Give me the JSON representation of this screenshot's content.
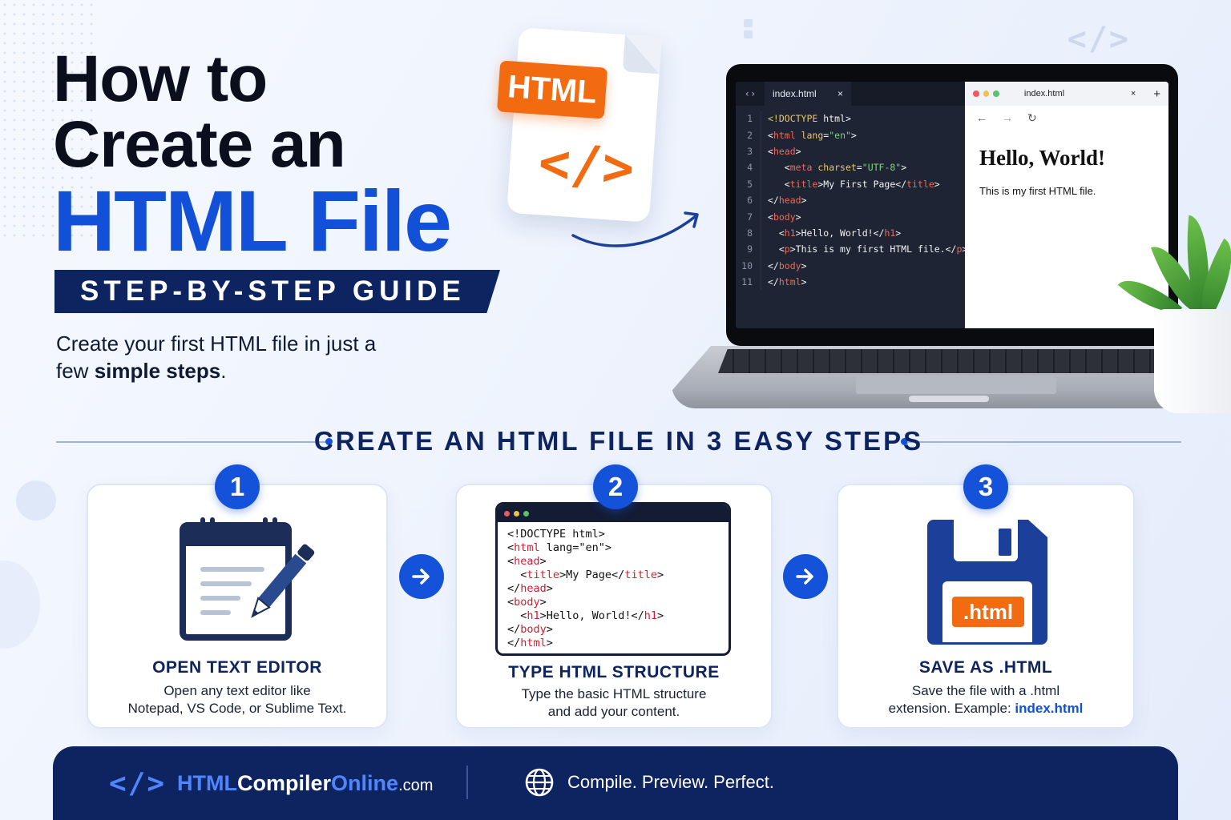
{
  "hero": {
    "title_line1": "How to",
    "title_line2": "Create an",
    "title_line3": "HTML File",
    "guide_banner": "STEP-BY-STEP GUIDE",
    "subtitle_part1": "Create your first HTML file in just a few ",
    "subtitle_bold": "simple steps",
    "subtitle_end": "."
  },
  "file_icon": {
    "badge": "HTML",
    "code_glyph": "</>"
  },
  "decor": {
    "code_glyph": "</>"
  },
  "editor": {
    "tab_icon": "‹›",
    "tab_name": "index.html",
    "tab_close": "×",
    "lines": [
      "1",
      "2",
      "3",
      "4",
      "5",
      "6",
      "7",
      "8",
      "9",
      "10",
      "11"
    ]
  },
  "browser": {
    "tab_name": "index.html",
    "tab_close": "×",
    "new_tab": "+",
    "nav_back": "←",
    "nav_forward": "→",
    "nav_reload": "↻",
    "heading": "Hello, World!",
    "paragraph": "This is my first HTML file."
  },
  "steps_section": {
    "heading": "CREATE AN HTML FILE IN 3 EASY STEPS",
    "steps": [
      {
        "number": "1",
        "title": "OPEN TEXT EDITOR",
        "desc_line1": "Open any text editor like",
        "desc_line2": "Notepad, VS Code, or Sublime Text."
      },
      {
        "number": "2",
        "title": "TYPE HTML STRUCTURE",
        "desc_line1": "Type the basic HTML structure",
        "desc_line2": "and add your content."
      },
      {
        "number": "3",
        "title": "SAVE AS .HTML",
        "desc_line1": "Save the file with a .html",
        "desc_line2_prefix": "extension. Example: ",
        "desc_line2_link": "index.html",
        "badge": ".html"
      }
    ]
  },
  "footer": {
    "brand_glyph": "</>",
    "brand_part1": "HTML",
    "brand_part2": "Compiler",
    "brand_part3": "Online",
    "brand_part4": ".com",
    "tagline": "Compile. Preview. Perfect."
  },
  "colors": {
    "accent_blue": "#1250d8",
    "navy": "#0d2460",
    "orange": "#f36b10"
  },
  "icons": [
    "file-html-icon",
    "curved-arrow-icon",
    "notepad-icon",
    "pencil-icon",
    "floppy-disk-icon",
    "arrow-right-icon",
    "globe-icon",
    "code-brackets-icon",
    "plant-decoration"
  ]
}
